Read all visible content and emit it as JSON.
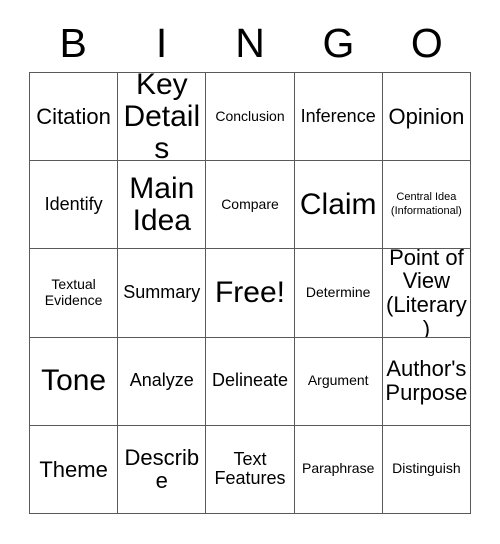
{
  "card": {
    "title_letters": [
      "B",
      "I",
      "N",
      "G",
      "O"
    ],
    "columns": 5,
    "rows": 5,
    "grid_line_color": "#5a5a5a",
    "background_color": "#ffffff",
    "text_color": "#000000",
    "cells": [
      {
        "text": "Citation",
        "size": "sz-lg"
      },
      {
        "text": "Key\nDetails",
        "size": "sz-xl"
      },
      {
        "text": "Conclusion",
        "size": "sz-sm"
      },
      {
        "text": "Inference",
        "size": "sz-md"
      },
      {
        "text": "Opinion",
        "size": "sz-lg"
      },
      {
        "text": "Identify",
        "size": "sz-md"
      },
      {
        "text": "Main\nIdea",
        "size": "sz-xl"
      },
      {
        "text": "Compare",
        "size": "sz-sm"
      },
      {
        "text": "Claim",
        "size": "sz-xl"
      },
      {
        "text": "Central Idea\n(Informational)",
        "size": "sz-xs"
      },
      {
        "text": "Textual\nEvidence",
        "size": "sz-sm"
      },
      {
        "text": "Summary",
        "size": "sz-md"
      },
      {
        "text": "Free!",
        "size": "sz-xl"
      },
      {
        "text": "Determine",
        "size": "sz-sm"
      },
      {
        "text": "Point of\nView\n(Literary)",
        "size": "sz-lg"
      },
      {
        "text": "Tone",
        "size": "sz-xl"
      },
      {
        "text": "Analyze",
        "size": "sz-md"
      },
      {
        "text": "Delineate",
        "size": "sz-md"
      },
      {
        "text": "Argument",
        "size": "sz-sm"
      },
      {
        "text": "Author's\nPurpose",
        "size": "sz-lg"
      },
      {
        "text": "Theme",
        "size": "sz-lg"
      },
      {
        "text": "Describe",
        "size": "sz-lg"
      },
      {
        "text": "Text\nFeatures",
        "size": "sz-md"
      },
      {
        "text": "Paraphrase",
        "size": "sz-sm"
      },
      {
        "text": "Distinguish",
        "size": "sz-sm"
      }
    ]
  }
}
